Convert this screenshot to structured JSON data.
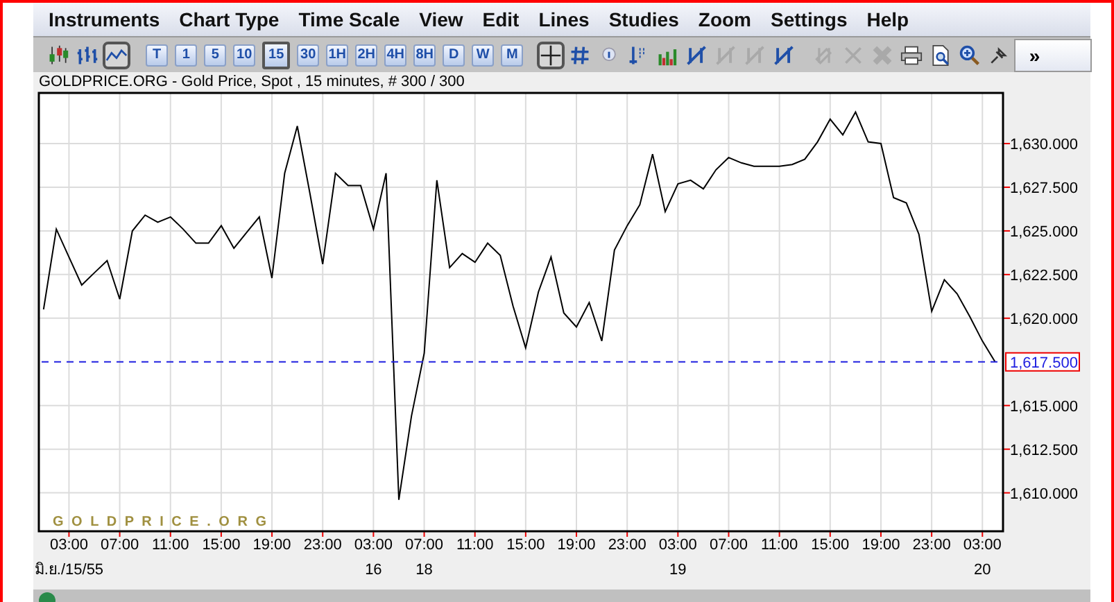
{
  "menu": [
    "Instruments",
    "Chart Type",
    "Time Scale",
    "View",
    "Edit",
    "Lines",
    "Studies",
    "Zoom",
    "Settings",
    "Help"
  ],
  "toolbar": {
    "chart_types": [
      {
        "kind": "candles",
        "selected": false
      },
      {
        "kind": "bars",
        "selected": false
      },
      {
        "kind": "line",
        "selected": true
      }
    ],
    "timescales": [
      {
        "label": "T",
        "selected": false
      },
      {
        "label": "1",
        "selected": false
      },
      {
        "label": "5",
        "selected": false
      },
      {
        "label": "10",
        "selected": false
      },
      {
        "label": "15",
        "selected": true
      },
      {
        "label": "30",
        "selected": false
      },
      {
        "label": "1H",
        "selected": false
      },
      {
        "label": "2H",
        "selected": false
      },
      {
        "label": "4H",
        "selected": false
      },
      {
        "label": "8H",
        "selected": false
      },
      {
        "label": "D",
        "selected": false
      },
      {
        "label": "W",
        "selected": false
      },
      {
        "label": "M",
        "selected": false
      }
    ],
    "tools": [
      {
        "kind": "crosshair",
        "selected": true,
        "disabled": false
      },
      {
        "kind": "grid",
        "selected": false,
        "disabled": false
      },
      {
        "kind": "info",
        "selected": false,
        "disabled": false
      },
      {
        "kind": "levels",
        "selected": false,
        "disabled": false
      },
      {
        "kind": "volume",
        "selected": false,
        "disabled": false
      },
      {
        "kind": "draw-line",
        "selected": false,
        "disabled": false
      },
      {
        "kind": "draw-line",
        "selected": false,
        "disabled": true
      },
      {
        "kind": "draw-line",
        "selected": false,
        "disabled": true
      },
      {
        "kind": "draw-line",
        "selected": false,
        "disabled": false
      },
      {
        "kind": "edit",
        "selected": false,
        "disabled": true
      },
      {
        "kind": "delete",
        "selected": false,
        "disabled": true
      },
      {
        "kind": "delete-all",
        "selected": false,
        "disabled": true
      },
      {
        "kind": "print",
        "selected": false,
        "disabled": false
      },
      {
        "kind": "preview",
        "selected": false,
        "disabled": false
      },
      {
        "kind": "zoom",
        "selected": false,
        "disabled": false
      },
      {
        "kind": "pin",
        "selected": false,
        "disabled": false
      }
    ],
    "overflow": "»"
  },
  "chart_title": "GOLDPRICE.ORG - Gold Price, Spot , 15 minutes, # 300 / 300",
  "chart": {
    "watermark": "G O L D P R I C E . O R G",
    "chart_data": {
      "type": "line",
      "grid": true,
      "ylim": [
        1607.8,
        1632.9
      ],
      "ref_lines": [
        {
          "axis": "y",
          "value": 1617.5,
          "label": "1,617.500"
        }
      ],
      "categories": [
        null,
        null,
        "03:00\nมิ.ย./15/55",
        null,
        null,
        null,
        "07:00",
        null,
        null,
        null,
        "11:00",
        null,
        null,
        null,
        "15:00",
        null,
        null,
        null,
        "19:00",
        null,
        null,
        null,
        "23:00",
        null,
        null,
        null,
        "03:00\n16",
        null,
        null,
        null,
        "07:00\n18",
        null,
        null,
        null,
        "11:00",
        null,
        null,
        null,
        "15:00",
        null,
        null,
        null,
        "19:00",
        null,
        null,
        null,
        "23:00",
        null,
        null,
        null,
        "03:00\n19",
        null,
        null,
        null,
        "07:00",
        null,
        null,
        null,
        "11:00",
        null,
        null,
        null,
        "15:00",
        null,
        null,
        null,
        "19:00",
        null,
        null,
        null,
        "23:00",
        null,
        null,
        null,
        "03:00\n20",
        null
      ],
      "yticks": [
        {
          "value": 1610,
          "label": "1,610.000"
        },
        {
          "value": 1612.5,
          "label": "1,612.500"
        },
        {
          "value": 1615,
          "label": "1,615.000"
        },
        {
          "value": 1620,
          "label": "1,620.000"
        },
        {
          "value": 1622.5,
          "label": "1,622.500"
        },
        {
          "value": 1625,
          "label": "1,625.000"
        },
        {
          "value": 1627.5,
          "label": "1,627.500"
        },
        {
          "value": 1630,
          "label": "1,630.000"
        }
      ],
      "series": [
        {
          "color": "#000000",
          "values": [
            1620.5,
            1625.1,
            1623.5,
            1621.9,
            1622.6,
            1623.3,
            1621.1,
            1625.0,
            1625.9,
            1625.5,
            1625.8,
            1625.1,
            1624.3,
            1624.3,
            1625.3,
            1624.0,
            1624.9,
            1625.8,
            1622.3,
            1628.3,
            1631.0,
            1627.1,
            1623.1,
            1628.3,
            1627.6,
            1627.6,
            1625.1,
            1628.3,
            1609.6,
            1614.4,
            1618.0,
            1627.9,
            1622.9,
            1623.7,
            1623.2,
            1624.3,
            1623.6,
            1620.7,
            1618.3,
            1621.5,
            1623.5,
            1620.3,
            1619.5,
            1620.9,
            1618.7,
            1623.9,
            1625.3,
            1626.5,
            1629.4,
            1626.1,
            1627.7,
            1627.9,
            1627.4,
            1628.5,
            1629.2,
            1628.9,
            1628.7,
            1628.7,
            1628.7,
            1628.8,
            1629.1,
            1630.1,
            1631.4,
            1630.5,
            1631.8,
            1630.1,
            1630.0,
            1626.9,
            1626.6,
            1624.8,
            1620.4,
            1622.2,
            1621.4,
            1620.1,
            1618.7,
            1617.5
          ]
        }
      ]
    }
  }
}
